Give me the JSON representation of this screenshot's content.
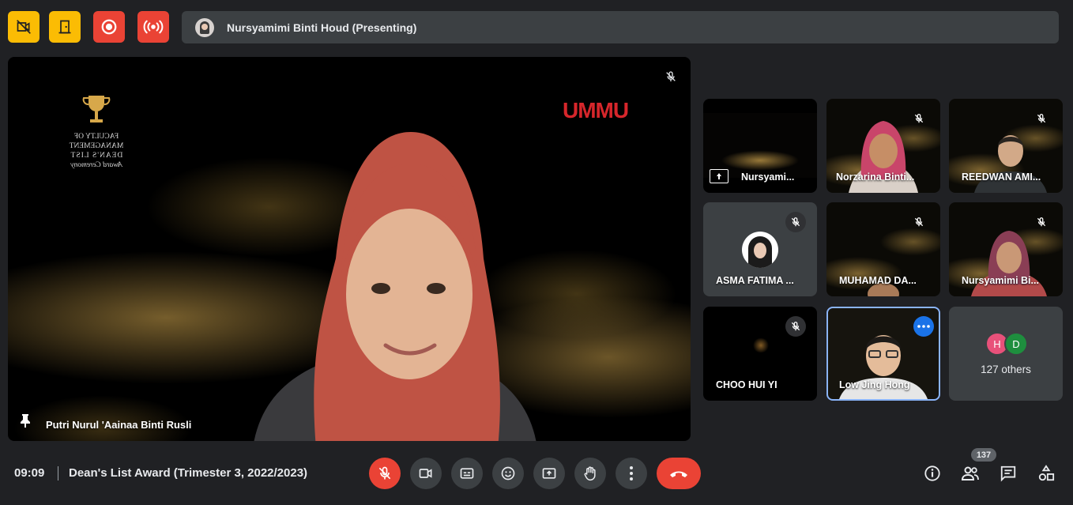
{
  "presenting_bar": {
    "text": "Nursyamimi Binti Houd (Presenting)"
  },
  "stage": {
    "pinned_name": "Putri Nurul 'Aainaa Binti Rusli",
    "slide_logo_text": "UMMU",
    "slide_caption_lines": [
      "FACULTY OF MANAGEMENT",
      "DEAN'S LIST",
      "Award Ceremony"
    ]
  },
  "tiles": [
    {
      "name": "Nursyami...",
      "kind": "presentation"
    },
    {
      "name": "Norzarina Binti...",
      "kind": "video"
    },
    {
      "name": "REEDWAN AMI...",
      "kind": "video"
    },
    {
      "name": "ASMA FATIMA ...",
      "kind": "avatar"
    },
    {
      "name": "MUHAMAD DA...",
      "kind": "video"
    },
    {
      "name": "Nursyamimi Bi...",
      "kind": "video"
    },
    {
      "name": "CHOO HUI YI",
      "kind": "dark"
    },
    {
      "name": "Low Jing Hong",
      "kind": "video-active"
    },
    {
      "initials": [
        "H",
        "D"
      ],
      "label": "127 others",
      "kind": "others"
    }
  ],
  "bottom": {
    "time": "09:09",
    "meeting_title": "Dean's List Award (Trimester 3, 2022/2023)",
    "participant_count": "137"
  },
  "icons": {
    "top": [
      "no-video-recording-icon",
      "door-exit-icon",
      "record-icon",
      "live-stream-icon"
    ],
    "controls": [
      "mic-off-icon",
      "camera-icon",
      "captions-icon",
      "emoji-icon",
      "present-icon",
      "raise-hand-icon",
      "more-vert-icon",
      "end-call-icon"
    ],
    "right": [
      "info-icon",
      "people-icon",
      "chat-icon",
      "activities-icon"
    ]
  },
  "colors": {
    "yellow": "#fbbc04",
    "red": "#ea4335",
    "active_border": "#8ab4f8",
    "surface": "#3c4043",
    "avatar_h": "#e8517a",
    "avatar_d": "#1e8e3e"
  }
}
